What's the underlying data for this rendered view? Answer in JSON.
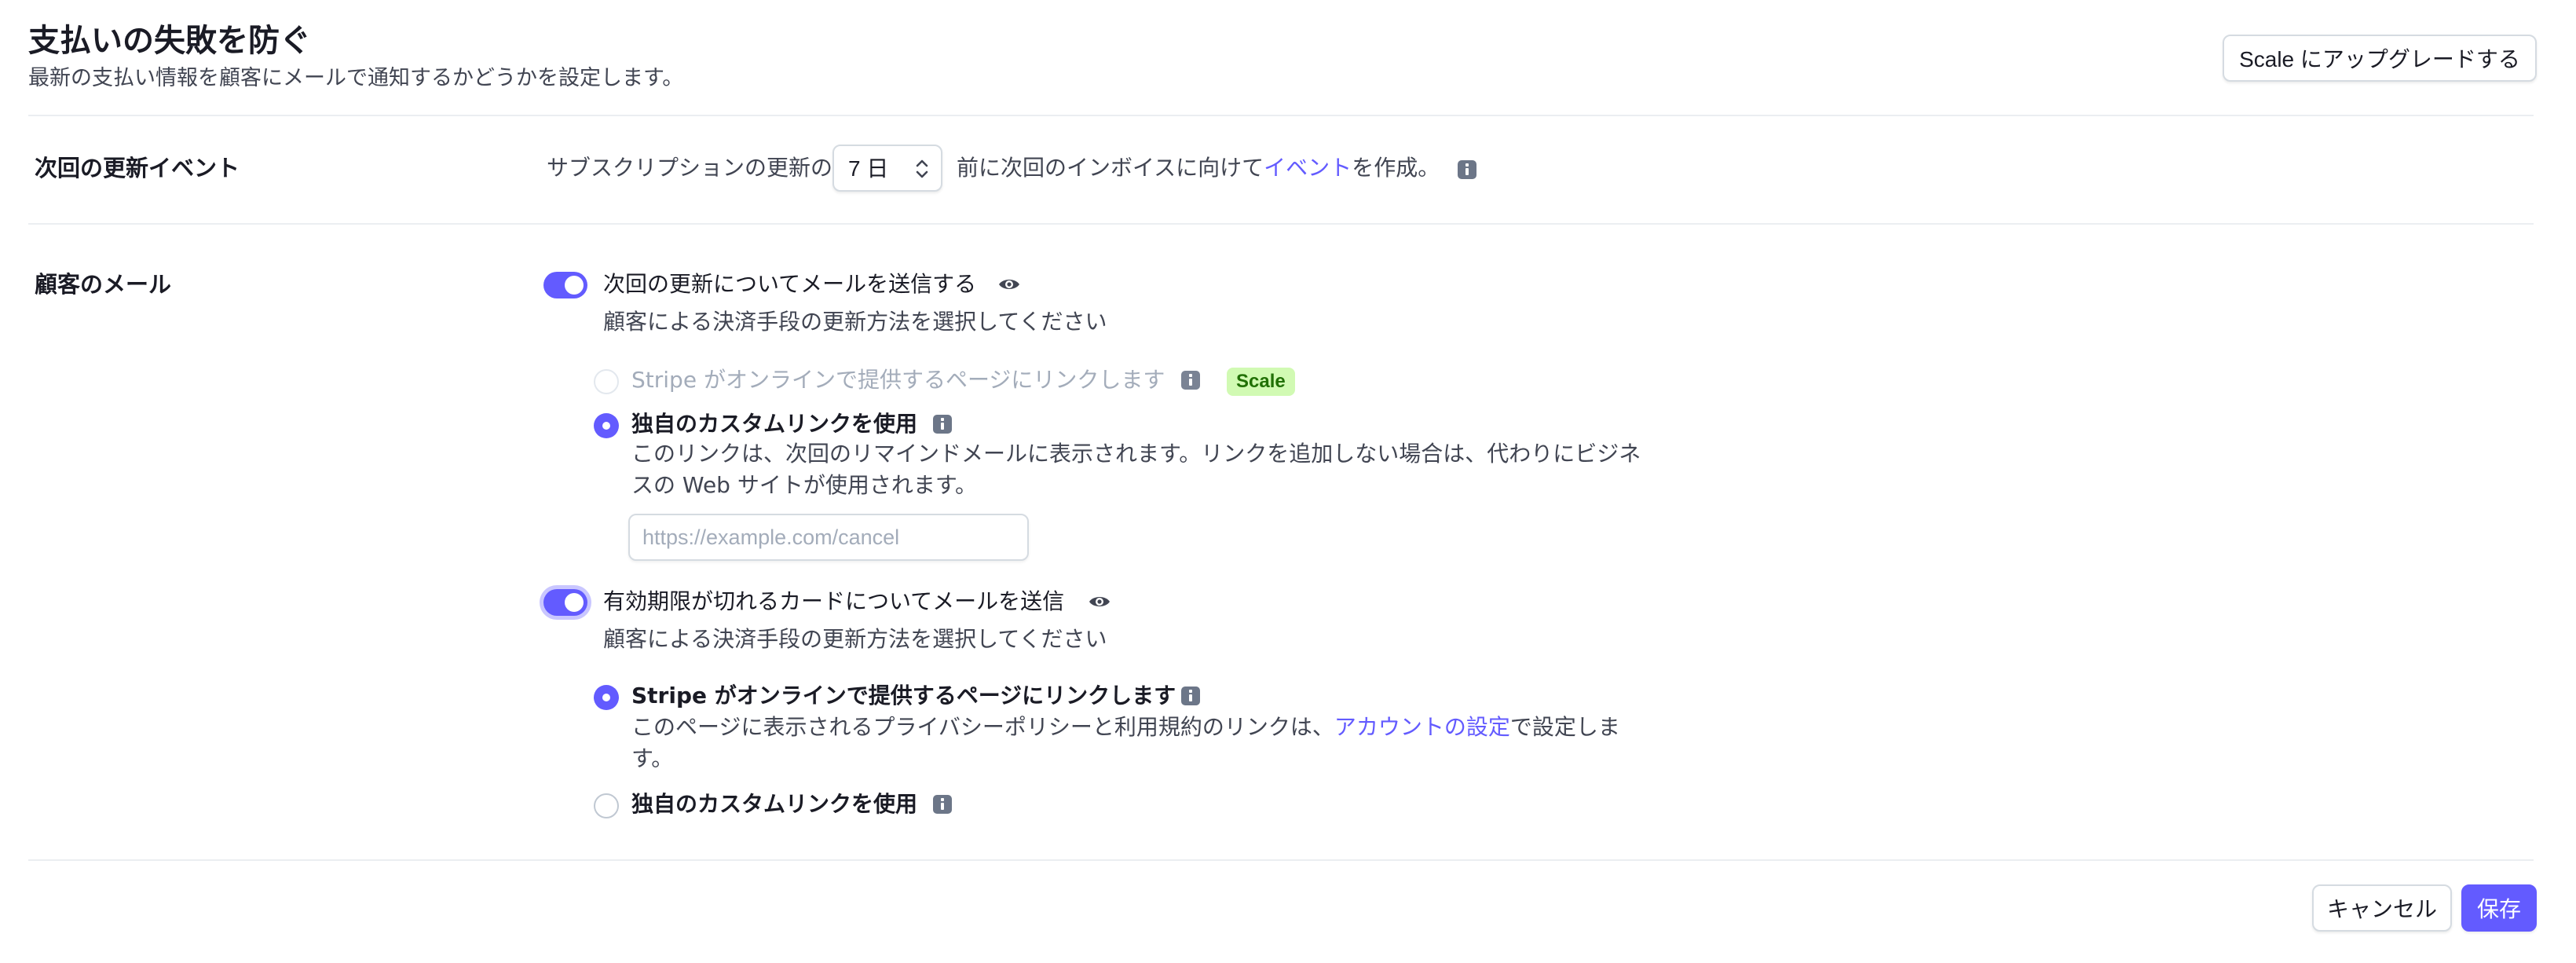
{
  "header": {
    "title": "支払いの失敗を防ぐ",
    "subtitle": "最新の支払い情報を顧客にメールで通知するかどうかを設定します。",
    "upgrade_button": "Scale にアップグレードする"
  },
  "renewal_event": {
    "label": "次回の更新イベント",
    "text_before": "サブスクリプションの更新の",
    "select_value": "7 日",
    "text_middle": "前に次回のインボイスに向けて",
    "link": "イベント",
    "text_after": "を作成。"
  },
  "customer_emails": {
    "label": "顧客のメール",
    "upcoming_renewal": {
      "toggle_label": "次回の更新についてメールを送信する",
      "enabled": true,
      "description": "顧客による決済手段の更新方法を選択してください",
      "options": [
        {
          "label": "Stripe がオンラインで提供するページにリンクします",
          "badge": "Scale",
          "disabled": true,
          "checked": false
        },
        {
          "label": "独自のカスタムリンクを使用",
          "checked": true,
          "help_line1": "このリンクは、次回のリマインドメールに表示されます。リンクを追加しない場合は、代わりにビジネ",
          "help_line2": "スの Web サイトが使用されます。"
        }
      ],
      "custom_link_placeholder": "https://example.com/cancel"
    },
    "expiring_cards": {
      "toggle_label": "有効期限が切れるカードについてメールを送信",
      "enabled": true,
      "description": "顧客による決済手段の更新方法を選択してください",
      "options": [
        {
          "label": "Stripe がオンラインで提供するページにリンクします",
          "checked": true,
          "help_before": "このページに表示されるプライバシーポリシーと利用規約のリンクは、",
          "help_link": "アカウントの設定",
          "help_after": "で設定しま",
          "help_line2": "す。"
        },
        {
          "label": "独自のカスタムリンクを使用",
          "checked": false
        }
      ]
    }
  },
  "footer": {
    "cancel_button": "キャンセル",
    "save_button": "保存"
  },
  "colors": {
    "accent": "#635bff",
    "badge_bg": "#d1fab3",
    "badge_text": "#217005",
    "divider": "#ebeef1"
  },
  "icons": [
    "info-icon",
    "eye-icon",
    "chevron-updown-icon"
  ]
}
